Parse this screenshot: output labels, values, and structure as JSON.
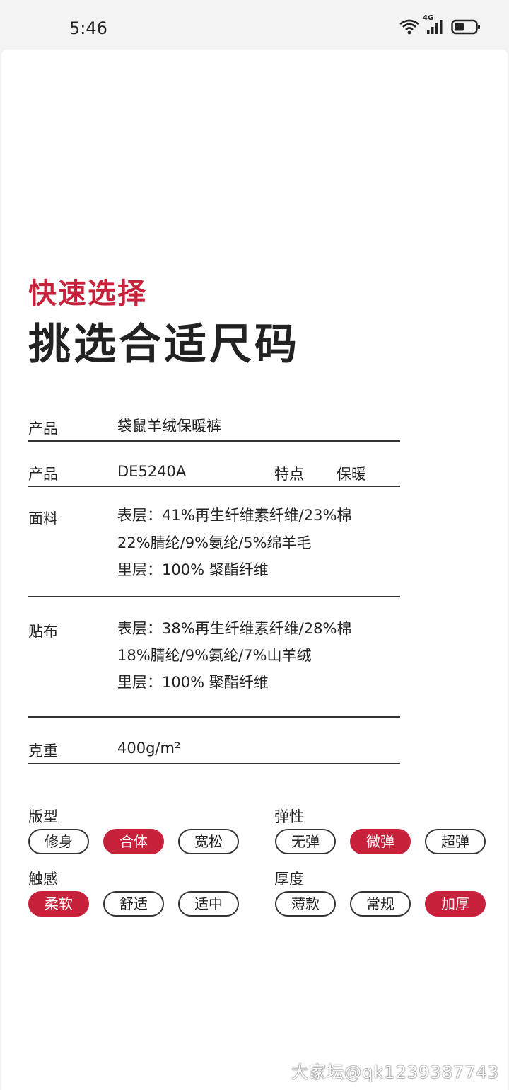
{
  "status": {
    "time": "5:46",
    "network": "4G"
  },
  "header": {
    "subtitle": "快速选择",
    "title": "挑选合适尺码"
  },
  "spec": {
    "product_name_label": "产品",
    "product_name_value": "袋鼠羊绒保暖裤",
    "product_code_label": "产品",
    "product_code_value": "DE5240A",
    "feature_label": "特点",
    "feature_value": "保暖",
    "fabric_label": "面料",
    "fabric_lines": [
      "表层：41%再生纤维素纤维/23%棉",
      "22%腈纶/9%氨纶/5%绵羊毛",
      "里层：100% 聚酯纤维"
    ],
    "patch_label": "贴布",
    "patch_lines": [
      "表层：38%再生纤维素纤维/28%棉",
      "18%腈纶/9%氨纶/7%山羊绒",
      "里层：100% 聚酯纤维"
    ],
    "weight_label": "克重",
    "weight_value": "400g/m²"
  },
  "options": {
    "fit": {
      "title": "版型",
      "items": [
        "修身",
        "合体",
        "宽松"
      ],
      "selected": "合体"
    },
    "elasticity": {
      "title": "弹性",
      "items": [
        "无弹",
        "微弹",
        "超弹"
      ],
      "selected": "微弹"
    },
    "touch": {
      "title": "触感",
      "items": [
        "柔软",
        "舒适",
        "适中"
      ],
      "selected": "柔软"
    },
    "thickness": {
      "title": "厚度",
      "items": [
        "薄款",
        "常规",
        "加厚"
      ],
      "selected": "加厚"
    }
  },
  "colors": {
    "accent": "#c8213b",
    "text": "#222222",
    "rule": "#333333"
  },
  "watermark": "大家坛@qk1239387743"
}
